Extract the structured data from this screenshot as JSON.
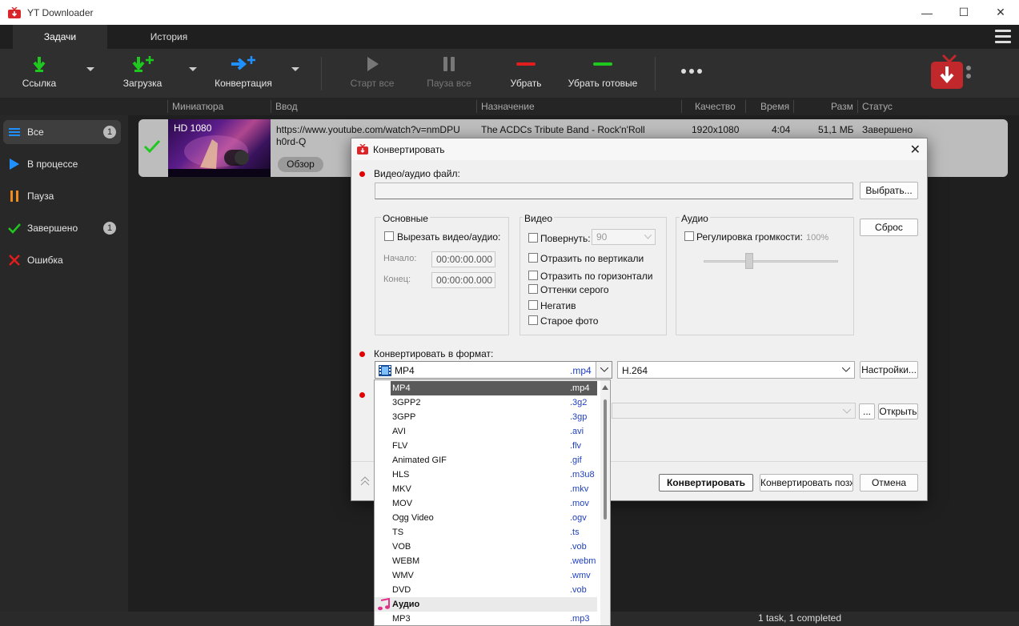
{
  "window": {
    "title": "YT Downloader"
  },
  "tabs": [
    {
      "label": "Задачи",
      "active": true
    },
    {
      "label": "История",
      "active": false
    }
  ],
  "toolbar": {
    "link": "Ссылка",
    "download": "Загрузка",
    "convert": "Конвертация",
    "start_all": "Старт все",
    "pause_all": "Пауза все",
    "remove": "Убрать",
    "remove_done": "Убрать готовые"
  },
  "columns": {
    "thumbnail": "Миниатюра",
    "input": "Ввод",
    "destination": "Назначение",
    "quality": "Качество",
    "time": "Время",
    "size": "Разм",
    "status": "Статус"
  },
  "sidebar": {
    "items": [
      {
        "label": "Все",
        "count": "1"
      },
      {
        "label": "В процессе"
      },
      {
        "label": "Пауза"
      },
      {
        "label": "Завершено",
        "count": "1"
      },
      {
        "label": "Ошибка"
      }
    ]
  },
  "task": {
    "thumb_label": "HD 1080",
    "url_line1": "https://www.youtube.com/watch?v=nmDPU",
    "url_line2": "h0rd-Q",
    "browse": "Обзор",
    "destination": "The ACDCs Tribute Band - Rock'n'Roll",
    "quality": "1920x1080",
    "time": "4:04",
    "size": "51,1 МБ",
    "status": "Завершено"
  },
  "dialog": {
    "title": "Конвертировать",
    "file_label": "Видео/аудио файл:",
    "choose": "Выбрать...",
    "reset": "Сброс",
    "basic": {
      "title": "Основные",
      "cut": "Вырезать видео/аудио:",
      "start_label": "Начало:",
      "start_value": "00:00:00.000",
      "end_label": "Конец:",
      "end_value": "00:00:00.000"
    },
    "video": {
      "title": "Видео",
      "rotate": "Повернуть:",
      "rotate_value": "90",
      "flip_v": "Отразить по вертикали",
      "flip_h": "Отразить по горизонтали",
      "gray": "Оттенки серого",
      "negative": "Негатив",
      "old_photo": "Старое фото"
    },
    "audio": {
      "title": "Аудио",
      "volume": "Регулировка громкости:",
      "volume_value": "100%"
    },
    "format_label": "Конвертировать в формат:",
    "format_selected": "MP4",
    "format_ext": ".mp4",
    "codec": "H.264",
    "settings": "Настройки...",
    "open": "Открыть",
    "dots": "...",
    "convert": "Конвертировать",
    "convert_later": "Конвертировать позже",
    "cancel": "Отмена"
  },
  "format_list": [
    {
      "name": "MP4",
      "ext": ".mp4"
    },
    {
      "name": "3GPP2",
      "ext": ".3g2"
    },
    {
      "name": "3GPP",
      "ext": ".3gp"
    },
    {
      "name": "AVI",
      "ext": ".avi"
    },
    {
      "name": "FLV",
      "ext": ".flv"
    },
    {
      "name": "Animated GIF",
      "ext": ".gif"
    },
    {
      "name": "HLS",
      "ext": ".m3u8"
    },
    {
      "name": "MKV",
      "ext": ".mkv"
    },
    {
      "name": "MOV",
      "ext": ".mov"
    },
    {
      "name": "Ogg Video",
      "ext": ".ogv"
    },
    {
      "name": "TS",
      "ext": ".ts"
    },
    {
      "name": "VOB",
      "ext": ".vob"
    },
    {
      "name": "WEBM",
      "ext": ".webm"
    },
    {
      "name": "WMV",
      "ext": ".wmv"
    },
    {
      "name": "DVD",
      "ext": ".vob"
    }
  ],
  "format_audio": {
    "category": "Аудио",
    "items": [
      {
        "name": "MP3",
        "ext": ".mp3"
      }
    ]
  },
  "statusbar": {
    "text": "1 task, 1 completed"
  },
  "colors": {
    "green": "#1ec81e",
    "blue": "#1e90ff",
    "red": "#e11d1d",
    "orange": "#f08c1e"
  }
}
